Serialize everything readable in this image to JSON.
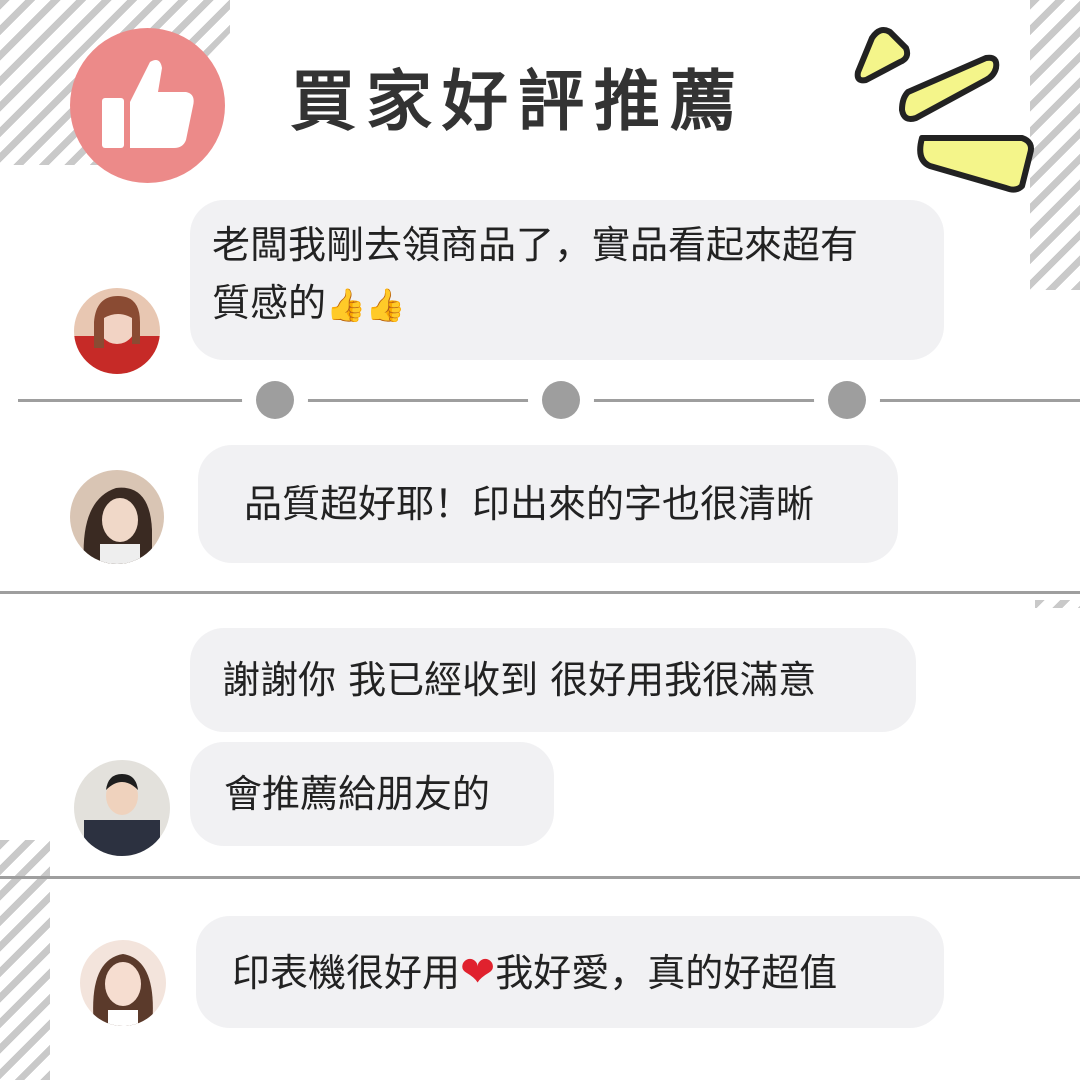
{
  "header": {
    "title": "買家好評推薦",
    "badge_icon": "thumbs-up-icon",
    "badge_color": "#ec8a89",
    "accent_color": "#f4f58a"
  },
  "reviews": [
    {
      "avatar": "avatar-woman-red-dress",
      "lines": [
        "老闆我剛去領商品了，實品看起來超有",
        "質感的"
      ],
      "emoji": "👍👍"
    },
    {
      "avatar": "avatar-woman-long-hair",
      "lines": [
        "品質超好耶！印出來的字也很清晰"
      ]
    },
    {
      "avatar": "avatar-man-suit",
      "lines": [
        "謝謝你 我已經收到 很好用我很滿意",
        "會推薦給朋友的"
      ]
    },
    {
      "avatar": "avatar-woman-smiling",
      "lines": [
        "印表機很好用",
        "我好愛，真的好超值"
      ],
      "emoji": "❤"
    }
  ]
}
